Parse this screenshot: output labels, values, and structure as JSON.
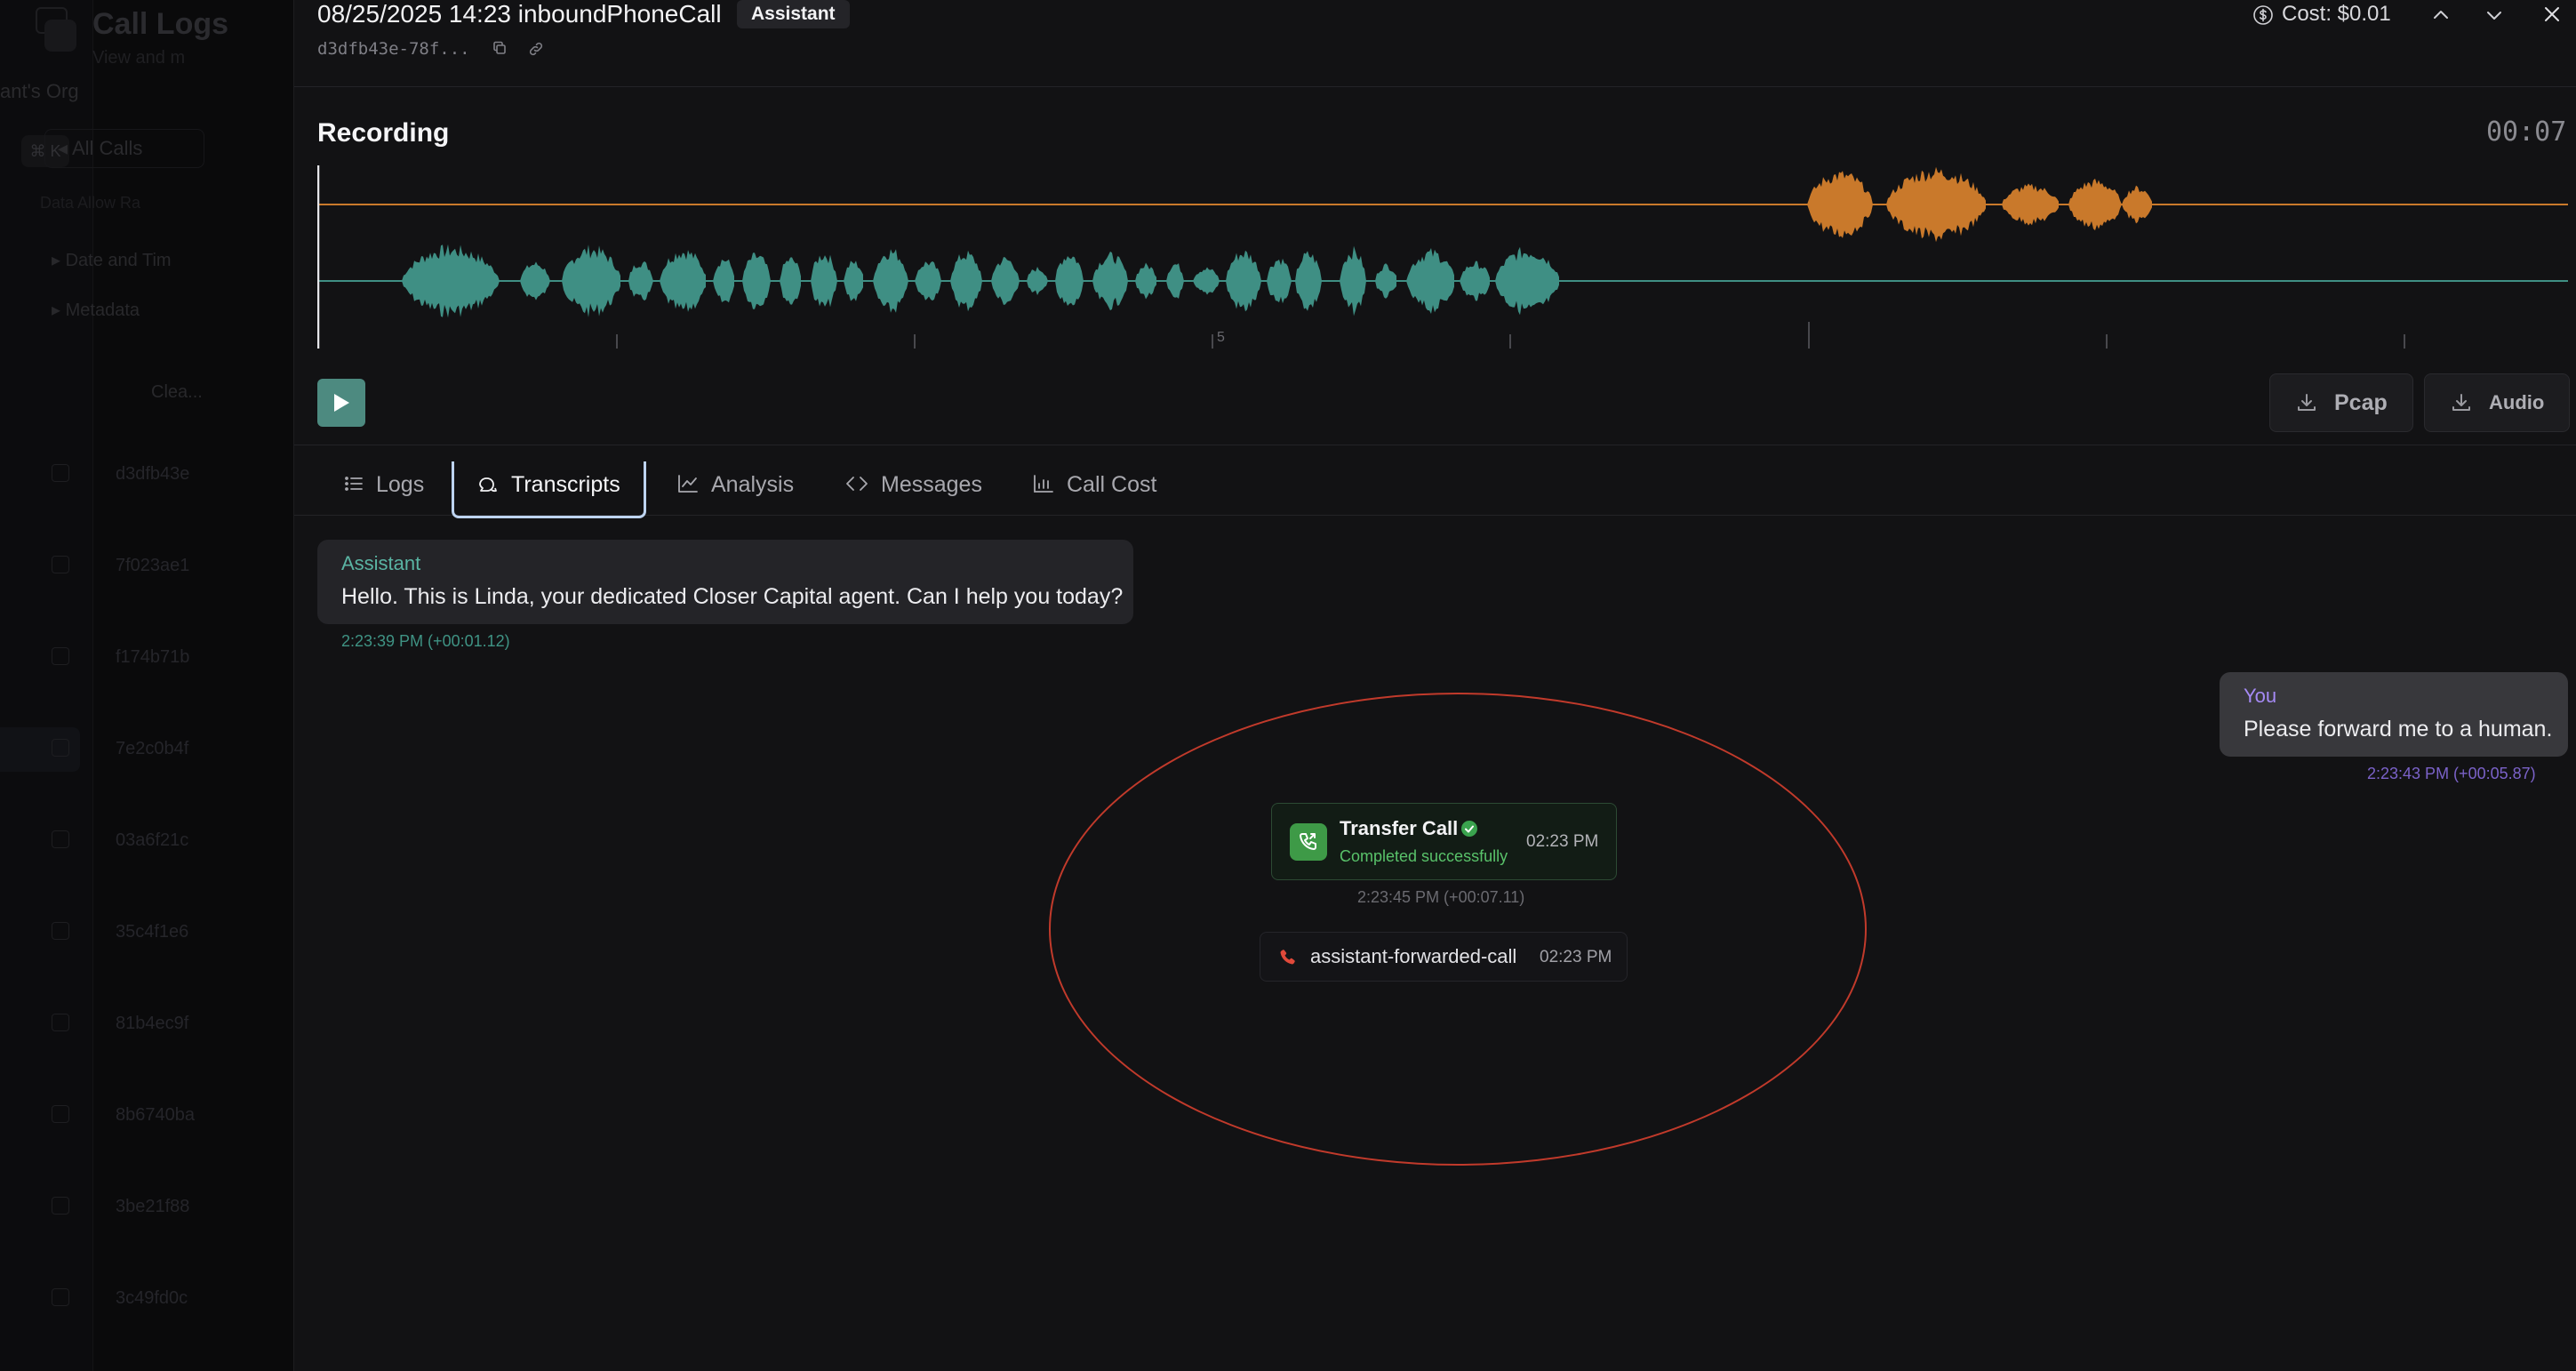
{
  "background_app": {
    "title": "Call Logs",
    "subtitle": "View and m",
    "rail_label": "ant's Org",
    "rail_pill": "⌘ K",
    "filter_label": "All Calls",
    "filter_note": "Data Allow Ra",
    "list_headers": [
      "Date and Tim",
      "Metadata"
    ],
    "select_label": "Clea...",
    "rows": [
      "d3dfb43e",
      "7f023ae1",
      "f174b71b",
      "7e2c0b4f",
      "03a6f21c",
      "35c4f1e6",
      "81b4ec9f",
      "8b6740ba",
      "3be21f88",
      "3c49fd0c"
    ]
  },
  "header": {
    "title": "08/25/2025 14:23 inboundPhoneCall",
    "badge": "Assistant",
    "call_id": "d3dfb43e-78f...",
    "cost": "Cost: $0.01"
  },
  "recording": {
    "title": "Recording",
    "duration": "00:07",
    "tick_label": "5",
    "play_icon": "play-icon",
    "pcap_label": "Pcap",
    "audio_label": "Audio",
    "colors": {
      "assistant_track": "#3f8f84",
      "user_track": "#c9792b"
    }
  },
  "tabs": [
    {
      "label": "Logs",
      "icon": "list-icon"
    },
    {
      "label": "Transcripts",
      "icon": "chat-icon",
      "active": true
    },
    {
      "label": "Analysis",
      "icon": "line-chart-icon"
    },
    {
      "label": "Messages",
      "icon": "code-icon"
    },
    {
      "label": "Call Cost",
      "icon": "bar-chart-icon"
    }
  ],
  "transcript": {
    "assistant_message": {
      "speaker": "Assistant",
      "text": "Hello. This is Linda, your dedicated Closer Capital agent. Can I help you today?",
      "timestamp": "2:23:39 PM (+00:01.12)"
    },
    "user_message": {
      "speaker": "You",
      "text": "Please forward me to a human.",
      "timestamp": "2:23:43 PM (+00:05.87)"
    },
    "tool_call": {
      "name": "Transfer Call",
      "status": "Completed successfully",
      "time": "02:23 PM",
      "timestamp": "2:23:45 PM (+00:07.11)"
    },
    "event": {
      "name": "assistant-forwarded-call",
      "time": "02:23 PM"
    }
  },
  "annotation_color": "#c13a2b"
}
